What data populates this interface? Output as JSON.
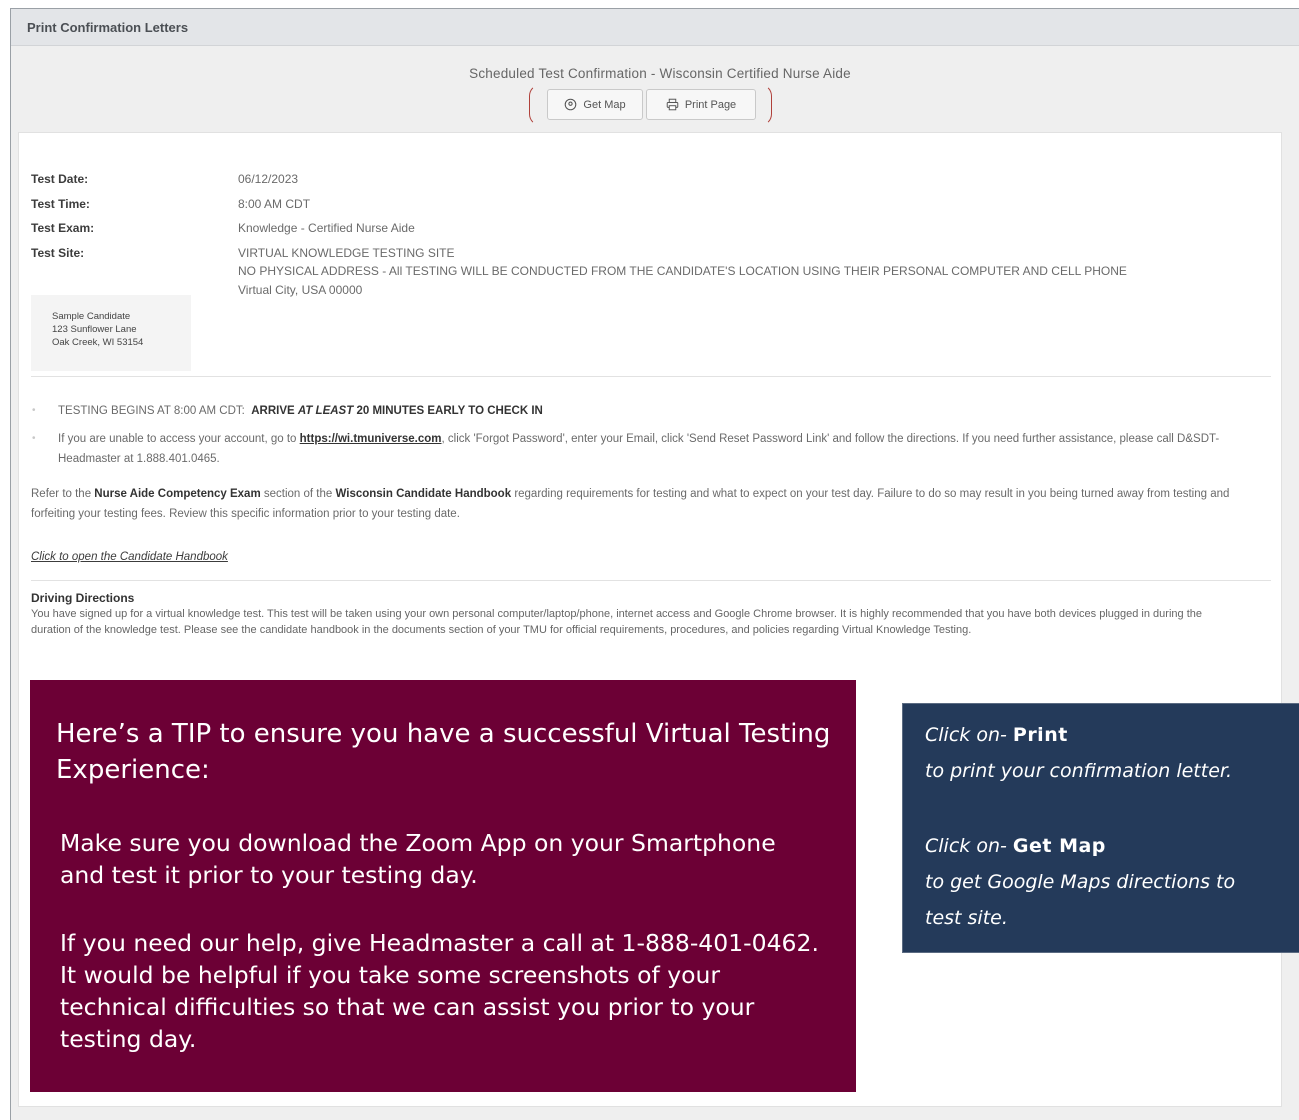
{
  "panel": {
    "title": "Print Confirmation Letters"
  },
  "header": {
    "subtitle": "Scheduled Test Confirmation - Wisconsin Certified Nurse Aide",
    "get_map_label": "Get Map",
    "print_page_label": "Print Page"
  },
  "details": {
    "date_label": "Test Date:",
    "date_value": "06/12/2023",
    "time_label": "Test Time:",
    "time_value": "8:00 AM CDT",
    "exam_label": "Test Exam:",
    "exam_value": "Knowledge - Certified Nurse Aide",
    "site_label": "Test Site:",
    "site_line1": "VIRTUAL KNOWLEDGE TESTING SITE",
    "site_line2": "NO PHYSICAL ADDRESS - All TESTING WILL BE CONDUCTED FROM THE CANDIDATE'S LOCATION USING THEIR PERSONAL COMPUTER AND CELL PHONE",
    "site_line3": "Virtual City, USA 00000"
  },
  "address": {
    "name": "Sample Candidate",
    "street": "123 Sunflower Lane",
    "city": "Oak Creek, WI 53154"
  },
  "bullets": {
    "b1_prefix": "TESTING BEGINS AT 8:00 AM CDT:",
    "b1_arrive": "ARRIVE",
    "b1_atleast": "AT LEAST",
    "b1_rest": "20 MINUTES EARLY TO CHECK IN",
    "b2_prefix": "If you are unable to access your account, go to",
    "b2_link": "https://wi.tmuniverse.com",
    "b2_rest": ", click 'Forgot Password', enter your Email, click 'Send Reset Password Link' and follow the directions.  If you need further assistance, please call D&SDT-Headmaster at 1.888.401.0465."
  },
  "refer": {
    "p1": "Refer to the",
    "b1": "Nurse Aide Competency Exam",
    "p2": "section of the",
    "b2": "Wisconsin Candidate Handbook",
    "p3": "regarding requirements for testing and what to expect on your test day.  Failure to do so may result in you being turned away from testing and forfeiting your testing fees.  Review this specific information prior to your testing date."
  },
  "handbook_link": "Click to open the Candidate Handbook",
  "driving": {
    "heading": "Driving Directions",
    "text": "You have signed up for a virtual knowledge test. This test will be taken using your own personal computer/laptop/phone, internet access and Google Chrome browser. It is highly recommended that you have both devices plugged in during the duration of the knowledge test. Please see the candidate handbook in the documents section of your TMU for official requirements, procedures, and policies regarding Virtual Knowledge Testing."
  },
  "tip": {
    "heading": "Here’s a TIP to ensure you have a successful Virtual Testing Experience:",
    "p1": "Make sure you download the Zoom App on your Smartphone and test it prior to your testing day.",
    "p2": "If you need our help, give Headmaster a call at 1-888-401-0462. It would be helpful if you take some screenshots of your technical difficulties so that we can assist you prior to your testing day."
  },
  "callout": {
    "click_on": "Click on-",
    "print_word": "Print",
    "print_desc": "to print your confirmation letter.",
    "map_word": "Get Map",
    "map_desc": "to get Google Maps directions to",
    "map_desc2": "test site."
  },
  "colors": {
    "tip_bg": "#6c0035",
    "callout_bg": "#243a5a",
    "bracket": "#b0403a"
  },
  "icons": {
    "map": "location-pin-icon",
    "print": "printer-icon"
  }
}
